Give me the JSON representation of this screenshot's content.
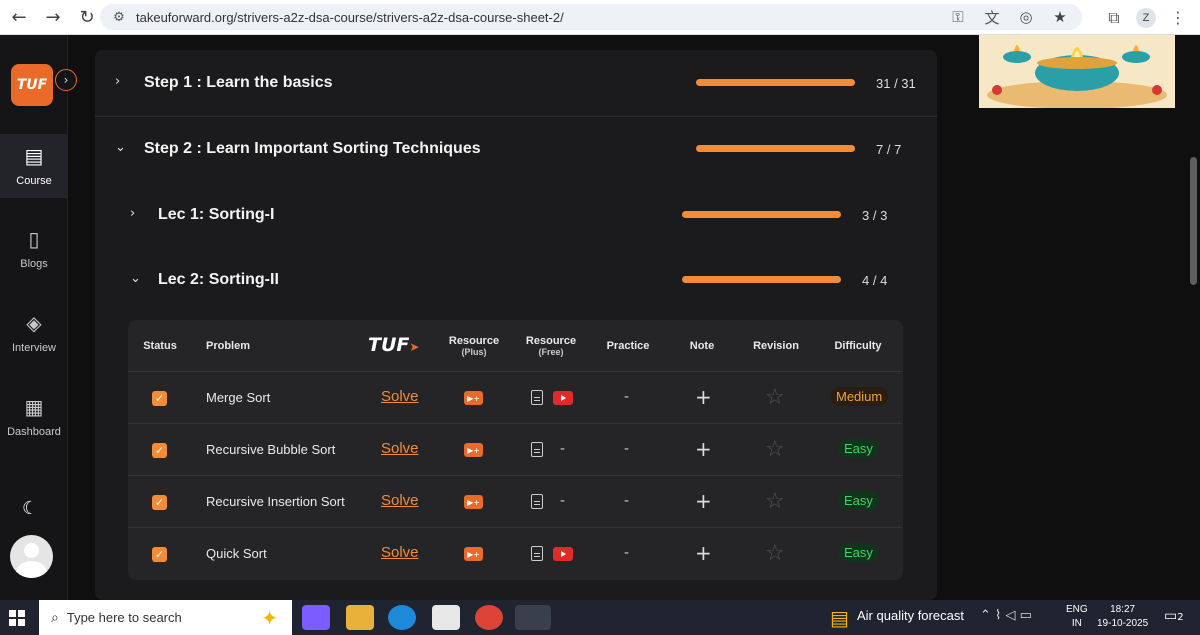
{
  "browser": {
    "url": "takeuforward.org/strivers-a2z-dsa-course/strivers-a2z-dsa-course-sheet-2/",
    "profile_initial": "Z"
  },
  "sidebar": {
    "logo": "TUF",
    "items": [
      {
        "label": "Course",
        "icon": "course-icon",
        "active": true
      },
      {
        "label": "Blogs",
        "icon": "blogs-icon",
        "active": false
      },
      {
        "label": "Interview",
        "icon": "interview-icon",
        "active": false
      },
      {
        "label": "Dashboard",
        "icon": "dashboard-icon",
        "active": false
      }
    ]
  },
  "steps": [
    {
      "title": "Step 1 : Learn the basics",
      "count": "31 / 31",
      "progress": 1.0,
      "expanded": false
    },
    {
      "title": "Step 2 : Learn Important Sorting Techniques",
      "count": "7 / 7",
      "progress": 1.0,
      "expanded": true
    }
  ],
  "lectures": [
    {
      "title": "Lec 1: Sorting-I",
      "count": "3 / 3",
      "progress": 1.0,
      "expanded": false
    },
    {
      "title": "Lec 2: Sorting-II",
      "count": "4 / 4",
      "progress": 1.0,
      "expanded": true
    }
  ],
  "table": {
    "headers": {
      "status": "Status",
      "problem": "Problem",
      "tuf": "TUF",
      "resource_plus": "Resource",
      "resource_plus_sub": "(Plus)",
      "resource_free": "Resource",
      "resource_free_sub": "(Free)",
      "practice": "Practice",
      "note": "Note",
      "revision": "Revision",
      "difficulty": "Difficulty"
    },
    "rows": [
      {
        "problem": "Merge Sort",
        "solve": "Solve",
        "practice": "-",
        "note": "+",
        "difficulty": "Medium",
        "has_video": true
      },
      {
        "problem": "Recursive Bubble Sort",
        "solve": "Solve",
        "practice": "-",
        "note": "+",
        "difficulty": "Easy",
        "has_video": false,
        "free_dash": "-"
      },
      {
        "problem": "Recursive Insertion Sort",
        "solve": "Solve",
        "practice": "-",
        "note": "+",
        "difficulty": "Easy",
        "has_video": false,
        "free_dash": "-"
      },
      {
        "problem": "Quick Sort",
        "solve": "Solve",
        "practice": "-",
        "note": "+",
        "difficulty": "Easy",
        "has_video": true
      }
    ]
  },
  "taskbar": {
    "search_placeholder": "Type here to search",
    "weather": "Air quality forecast",
    "lang_line1": "ENG",
    "lang_line2": "IN",
    "time": "18:27",
    "date": "19-10-2025",
    "notifications": "2"
  },
  "colors": {
    "accent": "#f28c38",
    "easy": "#3fd463",
    "medium": "#f2a23c"
  }
}
